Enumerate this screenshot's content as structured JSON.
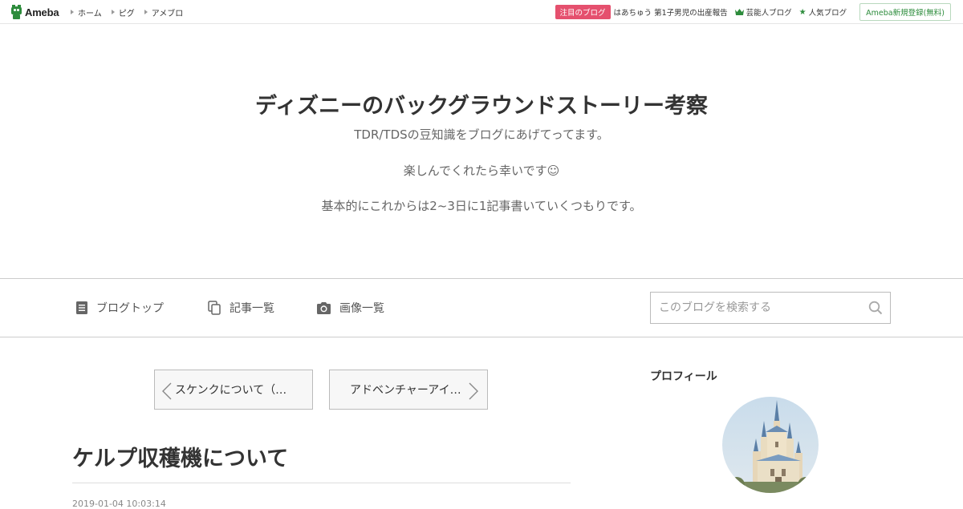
{
  "topbar": {
    "logo": "Ameba",
    "nav": [
      "ホーム",
      "ピグ",
      "アメブロ"
    ],
    "featured_badge": "注目のブログ",
    "featured_text": "はあちゅう 第1子男児の出産報告",
    "celebrity_link": "芸能人ブログ",
    "popular_link": "人気ブログ",
    "register_button": "Ameba新規登録(無料)"
  },
  "header": {
    "title": "ディズニーのバックグラウンドストーリー考察",
    "desc_lines": [
      "TDR/TDSの豆知識をブログにあげてってます。",
      "楽しんでくれたら幸いです☺",
      "基本的にこれからは2~3日に1記事書いていくつもりです。"
    ]
  },
  "navbar": {
    "items": [
      "ブログトップ",
      "記事一覧",
      "画像一覧"
    ],
    "search_placeholder": "このブログを検索する"
  },
  "pager": {
    "prev": "スケンクについて（…",
    "next": "アドベンチャーアイ…"
  },
  "article": {
    "title": "ケルプ収穫機について",
    "date": "2019-01-04 10:03:14"
  },
  "sidebar": {
    "heading": "プロフィール"
  },
  "colors": {
    "accent_green": "#2d8c3c",
    "badge_pink": "#e5506e"
  }
}
